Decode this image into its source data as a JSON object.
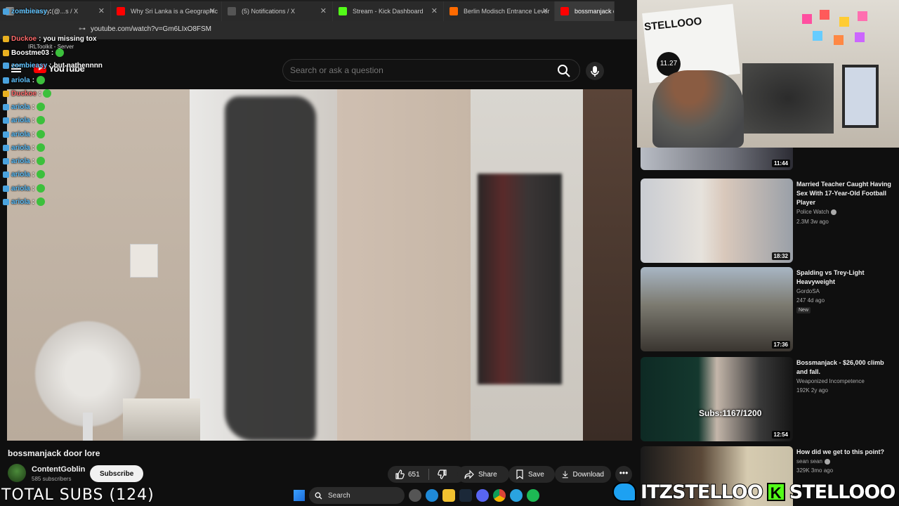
{
  "browser": {
    "tabs": [
      {
        "label": "zombieasy (@...s / X",
        "color": "#888888"
      },
      {
        "label": "Why Sri Lanka is a Geographic",
        "color": "#ff0000"
      },
      {
        "label": "(5) Notifications / X",
        "color": "#555555"
      },
      {
        "label": "Stream - Kick Dashboard",
        "color": "#53fc18"
      },
      {
        "label": "Berlin Modisch Entrance Lever",
        "color": "#ff6a00"
      },
      {
        "label": "bossmanjack door",
        "color": "#ff0000"
      }
    ],
    "url": "youtube.com/watch?v=Gm6LIxO8FSM",
    "bookmark": "IRLToolkit - Server"
  },
  "youtube": {
    "logo_text": "YouTube",
    "search_placeholder": "Search or ask a question"
  },
  "video": {
    "title": "bossmanjack door lore",
    "channel": "ContentGoblin",
    "subscribers": "585 subscribers",
    "subscribe_label": "Subscribe",
    "likes": "651",
    "share_label": "Share",
    "save_label": "Save",
    "download_label": "Download",
    "more_label": "•••"
  },
  "chat": [
    {
      "user": "zombieasy",
      "msg": "",
      "red": false
    },
    {
      "user": "Duckoe",
      "msg": "you missing tox",
      "red": true
    },
    {
      "user": "Boostme03",
      "msg": "",
      "red": false
    },
    {
      "user": "zombieasy",
      "msg": "but nathennnn",
      "red": false
    },
    {
      "user": "ariola",
      "msg": "",
      "red": false
    },
    {
      "user": "Duckoe",
      "msg": "",
      "red": true
    },
    {
      "user": "ariola",
      "msg": "",
      "red": false
    },
    {
      "user": "ariola",
      "msg": "",
      "red": false
    },
    {
      "user": "ariola",
      "msg": "",
      "red": false
    },
    {
      "user": "ariola",
      "msg": "",
      "red": false
    },
    {
      "user": "ariola",
      "msg": "",
      "red": false
    },
    {
      "user": "ariola",
      "msg": "",
      "red": false
    },
    {
      "user": "ariola",
      "msg": "",
      "red": false
    },
    {
      "user": "ariola",
      "msg": "",
      "red": false
    }
  ],
  "webcam": {
    "sign_text": "STELLOOO",
    "badge_text": "11.27"
  },
  "recommendations": [
    {
      "title": "",
      "channel": "",
      "stats": "",
      "duration": "11:44",
      "new": ""
    },
    {
      "title": "Married Teacher Caught Having Sex With 17-Year-Old Football Player",
      "channel": "Police Watch",
      "stats": "2.3M  3w ago",
      "duration": "18:32",
      "new": ""
    },
    {
      "title": "Spalding vs Trey-Light Heavyweight",
      "channel": "GordoSA",
      "stats": "247  4d ago",
      "duration": "17:36",
      "new": "New"
    },
    {
      "title": "Bossmanjack - $26,000 climb and fall.",
      "channel": "Weaponized Incompetence",
      "stats": "192K  2y ago",
      "duration": "12:54",
      "new": ""
    },
    {
      "title": "How did we get to this point?",
      "channel": "sean sean",
      "stats": "329K  3mo ago",
      "duration": "",
      "new": ""
    }
  ],
  "overlay": {
    "total_subs": "TOTAL SUBS (124)",
    "subs_goal": "Subs:1167/1200",
    "twitter_handle": "ITZSTELLOO",
    "kick_handle": "STELLOOO",
    "kick_letter": "K"
  },
  "taskbar": {
    "search_label": "Search"
  }
}
